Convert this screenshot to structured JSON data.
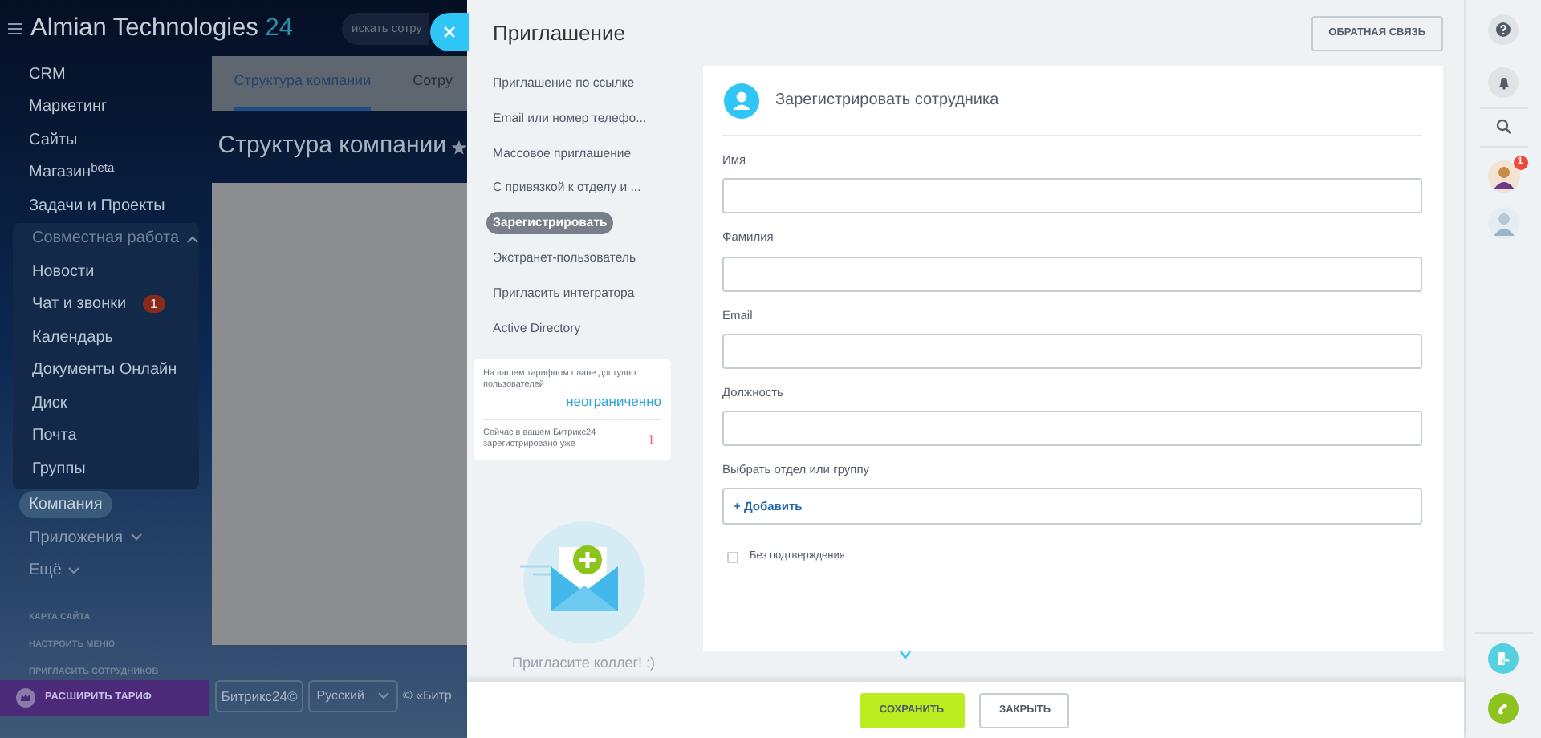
{
  "portal": {
    "logo": "Almian Technologies",
    "logo_suffix": "24",
    "search": {
      "placeholder": "искать сотру"
    },
    "sidebar": {
      "items": [
        {
          "kind": "link",
          "label": "CRM",
          "selected": false
        },
        {
          "kind": "link",
          "label": "Маркетинг",
          "selected": false
        },
        {
          "kind": "link",
          "label": "Сайты",
          "selected": false
        },
        {
          "kind": "link",
          "label": "Магазин$^{beta}$",
          "selected": false
        },
        {
          "kind": "link",
          "label": "Задачи и Проекты",
          "selected": false
        },
        {
          "kind": "group",
          "label": "Совместная работа",
          "expanded": true,
          "children": [
            {
              "label": "Новости",
              "selected": false
            },
            {
              "label": "Чат и звонки",
              "selected": false,
              "badge": "1"
            },
            {
              "label": "Календарь",
              "selected": false
            },
            {
              "label": "Документы Онлайн",
              "selected": false
            },
            {
              "label": "Диск",
              "selected": false
            },
            {
              "label": "Почта",
              "selected": false
            },
            {
              "label": "Группы",
              "selected": false
            }
          ]
        },
        {
          "kind": "link",
          "label": "Компания",
          "selected": true
        },
        {
          "kind": "group",
          "label": "Приложения",
          "expanded": false
        },
        {
          "kind": "group",
          "label": "Ещё",
          "expanded": false
        }
      ],
      "links": [
        "КАРТА САЙТА",
        "НАСТРОИТЬ МЕНЮ",
        "ПРИГЛАСИТЬ СОТРУДНИКОВ"
      ],
      "upgrade": "РАСШИРИТЬ ТАРИФ"
    },
    "tabs": [
      {
        "label": "Структура компании",
        "selected": true
      },
      {
        "label": "Сотру",
        "selected": false
      }
    ],
    "title": "Структура компании",
    "footer": {
      "logo": "Битрикс24©",
      "language": "Русский",
      "copyright": "© «Битр"
    }
  },
  "slider": {
    "title": "Приглашение",
    "feedback_button": "ОБРАТНАЯ СВЯЗЬ",
    "nav": [
      {
        "label": "Приглашение по ссылке",
        "selected": false
      },
      {
        "label": "Email или номер телефо...",
        "selected": false
      },
      {
        "label": "Массовое приглашение",
        "selected": false
      },
      {
        "label": "С привязкой к отделу и ...",
        "selected": false
      },
      {
        "label": "Зарегистрировать",
        "selected": true
      },
      {
        "label": "Экстранет-пользователь",
        "selected": false
      },
      {
        "label": "Пригласить интегратора",
        "selected": false
      },
      {
        "label": "Active Directory",
        "selected": false
      }
    ],
    "plan_info": [
      {
        "text": "На вашем тарифном плане доступно пользователей",
        "value": "неограниченно",
        "kind": "highlight"
      },
      {
        "text": "Сейчас в вашем Битрикс24 зарегистрировано уже",
        "value": "1",
        "kind": "count"
      }
    ],
    "invite_caption": "Пригласите коллег! :)",
    "form": {
      "title": "Зарегистрировать сотрудника",
      "fields": [
        {
          "kind": "text",
          "label": "Имя"
        },
        {
          "kind": "text",
          "label": "Фамилия"
        },
        {
          "kind": "text",
          "label": "Email"
        },
        {
          "kind": "text",
          "label": "Должность"
        },
        {
          "kind": "picker",
          "label": "Выбрать отдел или группу",
          "action": "+ Добавить"
        }
      ],
      "checkbox": {
        "label": "Без подтверждения",
        "checked": false
      }
    },
    "buttons": [
      {
        "kind": "primary",
        "label": "СОХРАНИТЬ"
      },
      {
        "kind": "secondary",
        "label": "ЗАКРЫТЬ"
      }
    ]
  },
  "rail": {
    "avatars": [
      {
        "kind": "woman",
        "badge": "1"
      },
      {
        "kind": "man"
      }
    ]
  }
}
